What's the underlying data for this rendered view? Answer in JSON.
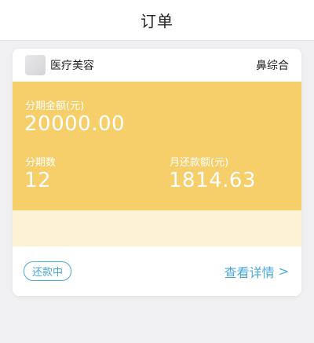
{
  "navbar": {
    "title": "订单"
  },
  "order": {
    "merchant": "医疗美容",
    "product": "鼻综合",
    "installment_amount_label": "分期金额(元)",
    "installment_amount": "20000.00",
    "installment_count_label": "分期数",
    "installment_count": "12",
    "monthly_payment_label": "月还款额(元)",
    "monthly_payment": "1814.63",
    "status": "还款中",
    "detail_link": "查看详情",
    "detail_chevron": ">"
  },
  "colors": {
    "panel": "#f6cf6a",
    "panel_light": "#fdf1d6",
    "accent": "#49a8da"
  }
}
